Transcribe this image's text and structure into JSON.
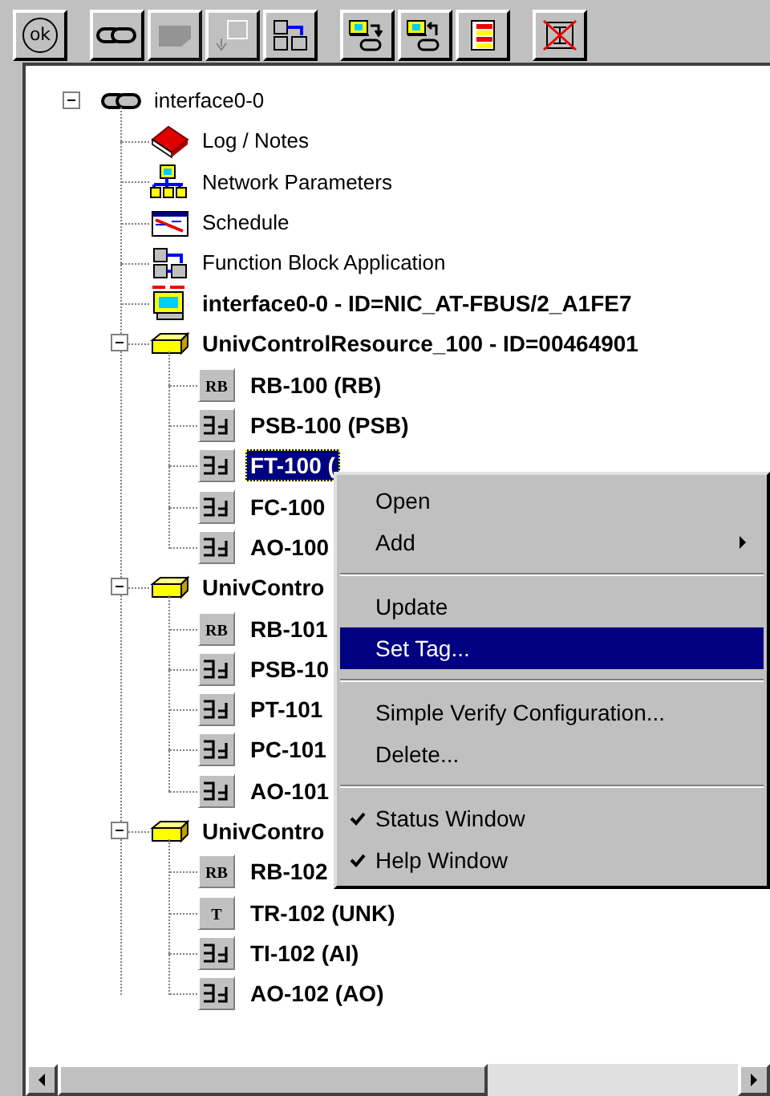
{
  "toolbar": [
    {
      "buttons": [
        {
          "kind": "ok",
          "label": "ok",
          "disabled": false
        }
      ]
    },
    {
      "buttons": [
        {
          "kind": "link",
          "disabled": false
        },
        {
          "kind": "blank",
          "disabled": true
        },
        {
          "kind": "pointer",
          "disabled": true
        },
        {
          "kind": "fba",
          "disabled": false
        }
      ]
    },
    {
      "buttons": [
        {
          "kind": "download",
          "disabled": false
        },
        {
          "kind": "upload",
          "disabled": false
        },
        {
          "kind": "list",
          "disabled": false
        }
      ]
    },
    {
      "buttons": [
        {
          "kind": "delete",
          "disabled": false
        }
      ]
    }
  ],
  "tree": [
    {
      "label": "interface0-0",
      "kind": "link",
      "expanded": true,
      "selected": false,
      "children": [
        {
          "label": "Log / Notes",
          "kind": "book",
          "selected": false
        },
        {
          "label": "Network Parameters",
          "kind": "network",
          "selected": false
        },
        {
          "label": "Schedule",
          "kind": "schedule",
          "selected": false
        },
        {
          "label": "Function Block Application",
          "kind": "fba",
          "selected": false
        },
        {
          "label": "interface0-0 - ID=NIC_AT-FBUS/2_A1FE7",
          "kind": "las",
          "selected": false
        },
        {
          "label": "UnivControlResource_100 - ID=00464901",
          "kind": "resource",
          "expanded": true,
          "selected": false,
          "children": [
            {
              "label": "RB-100 (RB)",
              "kind": "rb",
              "icon_text": "RB",
              "selected": false
            },
            {
              "label": "PSB-100 (PSB)",
              "kind": "block",
              "selected": false
            },
            {
              "label": "FT-100 (",
              "kind": "block",
              "selected": true
            },
            {
              "label": "FC-100",
              "kind": "block",
              "selected": false
            },
            {
              "label": "AO-100",
              "kind": "block",
              "selected": false
            }
          ]
        },
        {
          "label": "UnivContro",
          "kind": "resource",
          "expanded": true,
          "selected": false,
          "children": [
            {
              "label": "RB-101",
              "kind": "rb",
              "icon_text": "RB",
              "selected": false
            },
            {
              "label": "PSB-10",
              "kind": "block",
              "selected": false
            },
            {
              "label": "PT-101",
              "kind": "block",
              "selected": false
            },
            {
              "label": "PC-101",
              "kind": "block",
              "selected": false
            },
            {
              "label": "AO-101",
              "kind": "block",
              "selected": false
            }
          ]
        },
        {
          "label": "UnivContro",
          "kind": "resource",
          "expanded": true,
          "selected": false,
          "children": [
            {
              "label": "RB-102",
              "kind": "rb",
              "icon_text": "RB",
              "selected": false
            },
            {
              "label": "TR-102 (UNK)",
              "kind": "rb",
              "icon_text": "T",
              "selected": false
            },
            {
              "label": "TI-102 (AI)",
              "kind": "block",
              "selected": false
            },
            {
              "label": "AO-102 (AO)",
              "kind": "block",
              "selected": false
            }
          ]
        }
      ]
    }
  ],
  "context_menu": [
    {
      "kind": "item",
      "label": "Open",
      "selected": false,
      "checked": false
    },
    {
      "kind": "submenu",
      "label": "Add",
      "selected": false,
      "checked": false
    },
    {
      "kind": "separator"
    },
    {
      "kind": "item",
      "label": "Update",
      "selected": false,
      "checked": false
    },
    {
      "kind": "item",
      "label": "Set Tag...",
      "selected": true,
      "checked": false
    },
    {
      "kind": "separator"
    },
    {
      "kind": "item",
      "label": "Simple Verify Configuration...",
      "selected": false,
      "checked": false
    },
    {
      "kind": "item",
      "label": "Delete...",
      "selected": false,
      "checked": false
    },
    {
      "kind": "separator"
    },
    {
      "kind": "item",
      "label": "Status Window",
      "selected": false,
      "checked": true
    },
    {
      "kind": "item",
      "label": "Help Window",
      "selected": false,
      "checked": true
    }
  ]
}
